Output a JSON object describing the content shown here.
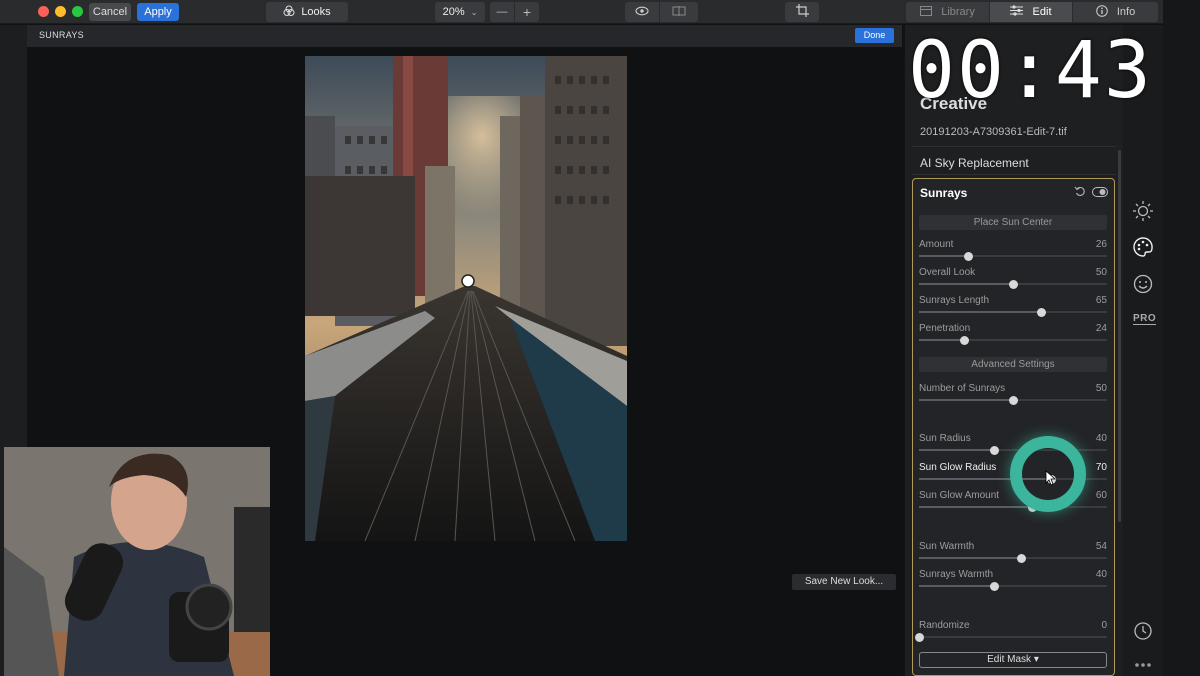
{
  "toolbar": {
    "cancel_label": "Cancel",
    "apply_label": "Apply",
    "looks_label": "Looks",
    "zoom": "20%",
    "zoom_out": "—",
    "zoom_in": "+",
    "tabs": [
      {
        "label": "Library"
      },
      {
        "label": "Edit"
      },
      {
        "label": "Info"
      }
    ]
  },
  "subheader": {
    "title": "SUNRAYS",
    "done_label": "Done"
  },
  "timer": "00:43",
  "panel": {
    "partial_heading": "Creative",
    "filename": "20191203-A7309361-Edit-7.tif",
    "sky_label": "AI Sky Replacement",
    "sunrays": {
      "title": "Sunrays",
      "place_sun_label": "Place Sun Center",
      "advanced_label": "Advanced Settings",
      "sliders": [
        {
          "label": "Amount",
          "value": "26",
          "pos": 0.26
        },
        {
          "label": "Overall Look",
          "value": "50",
          "pos": 0.5
        },
        {
          "label": "Sunrays Length",
          "value": "65",
          "pos": 0.65
        },
        {
          "label": "Penetration",
          "value": "24",
          "pos": 0.24
        },
        {
          "label": "Number of Sunrays",
          "value": "50",
          "pos": 0.5
        },
        {
          "label": "Sun Radius",
          "value": "40",
          "pos": 0.4
        },
        {
          "label": "Sun Glow Radius",
          "value": "70",
          "pos": 0.7
        },
        {
          "label": "Sun Glow Amount",
          "value": "60",
          "pos": 0.6
        },
        {
          "label": "Sun Warmth",
          "value": "54",
          "pos": 0.54
        },
        {
          "label": "Sunrays Warmth",
          "value": "40",
          "pos": 0.4
        },
        {
          "label": "Randomize",
          "value": "0",
          "pos": 0
        }
      ],
      "edit_mask_label": "Edit Mask ▾"
    }
  },
  "canvas": {
    "save_look_label": "Save New Look..."
  },
  "icons": {
    "pro_label": "PRO"
  },
  "colors": {
    "accent": "#2a71d9",
    "panel_border": "#b49a5a",
    "glow_ring": "#3bb59b"
  }
}
